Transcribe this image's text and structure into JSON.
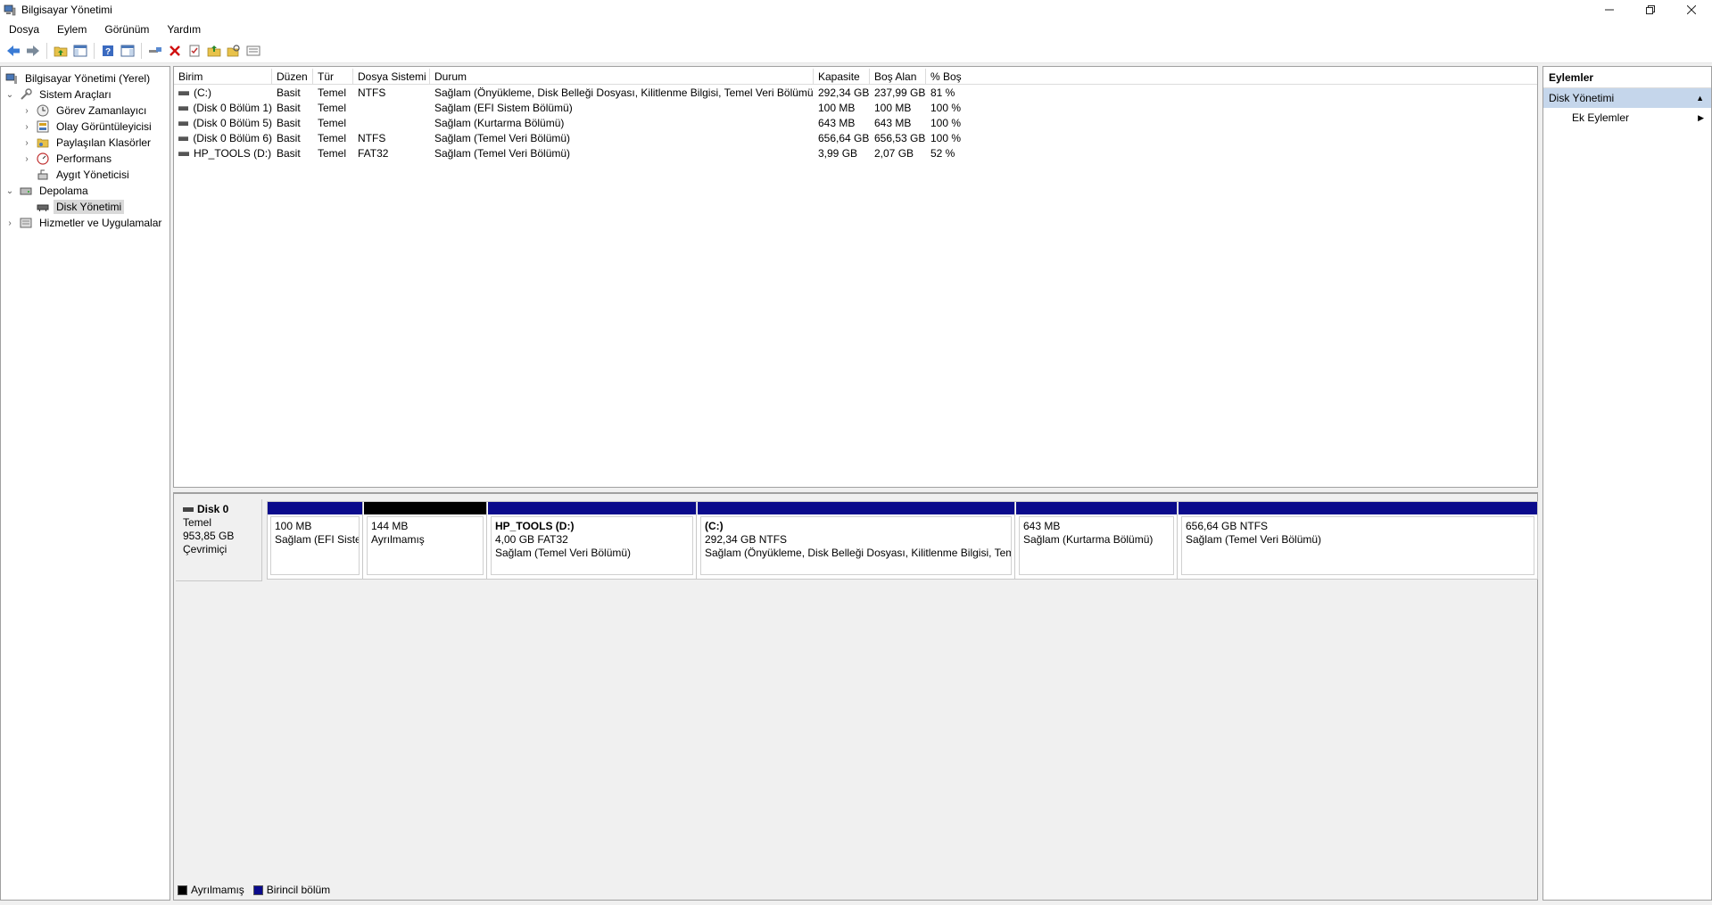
{
  "window": {
    "title": "Bilgisayar Yönetimi"
  },
  "menu": [
    "Dosya",
    "Eylem",
    "Görünüm",
    "Yardım"
  ],
  "tree": {
    "root": "Bilgisayar Yönetimi (Yerel)",
    "system_tools": "Sistem Araçları",
    "task_scheduler": "Görev Zamanlayıcı",
    "event_viewer": "Olay Görüntüleyicisi",
    "shared_folders": "Paylaşılan Klasörler",
    "performance": "Performans",
    "device_manager": "Aygıt Yöneticisi",
    "storage": "Depolama",
    "disk_management": "Disk Yönetimi",
    "services_apps": "Hizmetler ve Uygulamalar"
  },
  "volumes": {
    "headers": [
      "Birim",
      "Düzen",
      "Tür",
      "Dosya Sistemi",
      "Durum",
      "Kapasite",
      "Boş Alan",
      "% Boş"
    ],
    "rows": [
      [
        "(C:)",
        "Basit",
        "Temel",
        "NTFS",
        "Sağlam (Önyükleme, Disk Belleği Dosyası, Kilitlenme Bilgisi, Temel Veri Bölümü)",
        "292,34 GB",
        "237,99 GB",
        "81 %"
      ],
      [
        "(Disk 0 Bölüm 1)",
        "Basit",
        "Temel",
        "",
        "Sağlam (EFI Sistem Bölümü)",
        "100 MB",
        "100 MB",
        "100 %"
      ],
      [
        "(Disk 0 Bölüm 5)",
        "Basit",
        "Temel",
        "",
        "Sağlam (Kurtarma Bölümü)",
        "643 MB",
        "643 MB",
        "100 %"
      ],
      [
        "(Disk 0 Bölüm 6)",
        "Basit",
        "Temel",
        "NTFS",
        "Sağlam (Temel Veri Bölümü)",
        "656,64 GB",
        "656,53 GB",
        "100 %"
      ],
      [
        "HP_TOOLS (D:)",
        "Basit",
        "Temel",
        "FAT32",
        "Sağlam (Temel Veri Bölümü)",
        "3,99 GB",
        "2,07 GB",
        "52 %"
      ]
    ]
  },
  "disk": {
    "name": "Disk 0",
    "type": "Temel",
    "size": "953,85 GB",
    "status": "Çevrimiçi",
    "partitions": [
      {
        "name": "",
        "size": "100 MB",
        "status": "Sağlam (EFI Sistem Bö"
      },
      {
        "name": "",
        "size": "144 MB",
        "status": "Ayrılmamış"
      },
      {
        "name": "HP_TOOLS  (D:)",
        "size": "4,00 GB FAT32",
        "status": "Sağlam (Temel Veri Bölümü)"
      },
      {
        "name": "(C:)",
        "size": "292,34 GB NTFS",
        "status": "Sağlam (Önyükleme, Disk Belleği Dosyası, Kilitlenme Bilgisi, Tem"
      },
      {
        "name": "",
        "size": "643 MB",
        "status": "Sağlam (Kurtarma Bölümü)"
      },
      {
        "name": "",
        "size": "656,64 GB NTFS",
        "status": "Sağlam (Temel Veri Bölümü)"
      }
    ]
  },
  "legend": {
    "unallocated": "Ayrılmamış",
    "primary": "Birincil bölüm"
  },
  "actions": {
    "title": "Eylemler",
    "section": "Disk Yönetimi",
    "more": "Ek Eylemler"
  },
  "colors": {
    "primary_partition": "#0b0b8c",
    "unallocated": "#000000",
    "selection": "#c5d6eb"
  }
}
